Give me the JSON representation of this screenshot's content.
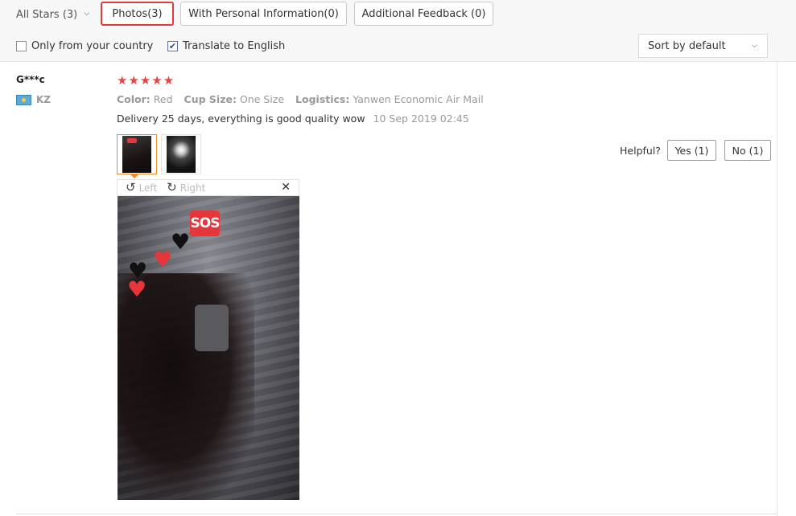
{
  "filters": {
    "stars_dropdown": {
      "label": "All Stars (3)",
      "icon": "chevron-down-icon"
    },
    "tabs": [
      {
        "label": "Photos(3)",
        "active": true
      },
      {
        "label": "With Personal Information(0)",
        "active": false
      },
      {
        "label": "Additional Feedback (0)",
        "active": false
      }
    ],
    "checkboxes": [
      {
        "label": "Only from your country",
        "checked": false
      },
      {
        "label": "Translate to English",
        "checked": true
      }
    ],
    "sort": {
      "value": "Sort by default",
      "icon": "chevron-down-icon"
    },
    "active_color": "#e23a3a"
  },
  "review": {
    "user": {
      "name": "G***c",
      "country_code": "KZ",
      "flag_icon": "kazakhstan-flag-icon"
    },
    "rating": {
      "stars": 5,
      "max": 5,
      "glyph": "★★★★★",
      "color": "#e64545"
    },
    "properties": [
      {
        "key": "Color:",
        "value": "Red"
      },
      {
        "key": "Cup Size:",
        "value": "One Size"
      },
      {
        "key": "Logistics:",
        "value": "Yanwen Economic Air Mail"
      }
    ],
    "text": "Delivery 25 days, everything is good quality wow",
    "date": "10 Sep 2019 02:45",
    "photo_viewer": {
      "left_label": "Left",
      "right_label": "Right",
      "left_icon": "rotate-left-icon",
      "right_icon": "rotate-right-icon",
      "close_icon": "close-icon",
      "photo_sticker": "SOS"
    },
    "helpful": {
      "label": "Helpful?",
      "yes_label": "Yes (1)",
      "no_label": "No (1)"
    }
  }
}
